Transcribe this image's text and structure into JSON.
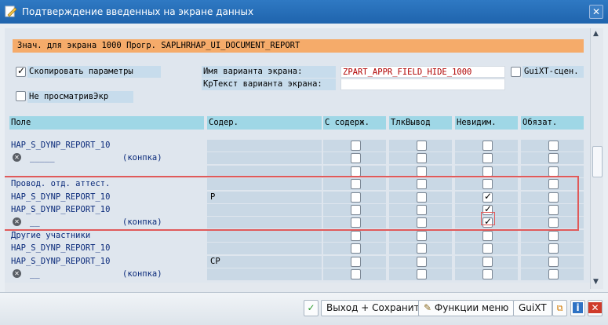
{
  "window": {
    "title": "Подтверждение введенных на экране данных",
    "close_glyph": "✕"
  },
  "info": {
    "text": "Знач. для экрана 1000 Прогр.   SAPLHRHAP_UI_DOCUMENT_REPORT"
  },
  "options": {
    "copy_params": {
      "label": "Скопировать параметры",
      "checked": true
    },
    "no_view": {
      "label": "Не просматривЭкр",
      "checked": false
    },
    "variant_name_label": "Имя варианта экрана:",
    "variant_name_value": "ZPART_APPR_FIELD_HIDE_1000",
    "short_text_label": "КрТекст варианта экрана:",
    "short_text_value": "",
    "guixt": {
      "label": "GuiXT-сцен.",
      "checked": false
    }
  },
  "table": {
    "headers": [
      "Поле",
      "Содер.",
      "С содерж.",
      "ТлкВывод",
      "Невидим.",
      "Обязат."
    ],
    "rows": [
      {
        "field": "HAP_S_DYNP_REPORT_10",
        "content": "",
        "checks": [
          false,
          false,
          false,
          false
        ]
      },
      {
        "field": "_____",
        "suffix": "(конпка)",
        "icon": true,
        "content": "",
        "checks": [
          false,
          false,
          false,
          false
        ]
      },
      {
        "field": "",
        "content": "",
        "checks": [
          false,
          false,
          false,
          false
        ]
      },
      {
        "field": "Провод. отд. аттест.",
        "content": "",
        "checks": [
          false,
          false,
          false,
          false
        ]
      },
      {
        "field": "HAP_S_DYNP_REPORT_10",
        "content": "P",
        "checks": [
          false,
          false,
          true,
          false
        ]
      },
      {
        "field": "HAP_S_DYNP_REPORT_10",
        "content": "",
        "checks": [
          false,
          false,
          true,
          false
        ]
      },
      {
        "field": "__",
        "suffix": "(конпка)",
        "icon": true,
        "content": "",
        "checks": [
          false,
          false,
          true,
          false
        ]
      },
      {
        "field": "Другие участники",
        "content": "",
        "checks": [
          false,
          false,
          false,
          false
        ]
      },
      {
        "field": "HAP_S_DYNP_REPORT_10",
        "content": "",
        "checks": [
          false,
          false,
          false,
          false
        ]
      },
      {
        "field": "HAP_S_DYNP_REPORT_10",
        "content": "CP",
        "checks": [
          false,
          false,
          false,
          false
        ]
      },
      {
        "field": "__",
        "suffix": "(конпка)",
        "icon": true,
        "content": "",
        "checks": [
          false,
          false,
          false,
          false
        ]
      }
    ]
  },
  "buttons": {
    "exit_save": "Выход + Сохранить",
    "functions": "Функции меню",
    "guixt": "GuiXT"
  },
  "colors": {
    "title_bar": "#2472be",
    "info_bar": "#f5ab6a",
    "header_cells": "#9fd7e6",
    "highlight_box": "#e05a5a",
    "variant_text": "#b00000"
  }
}
